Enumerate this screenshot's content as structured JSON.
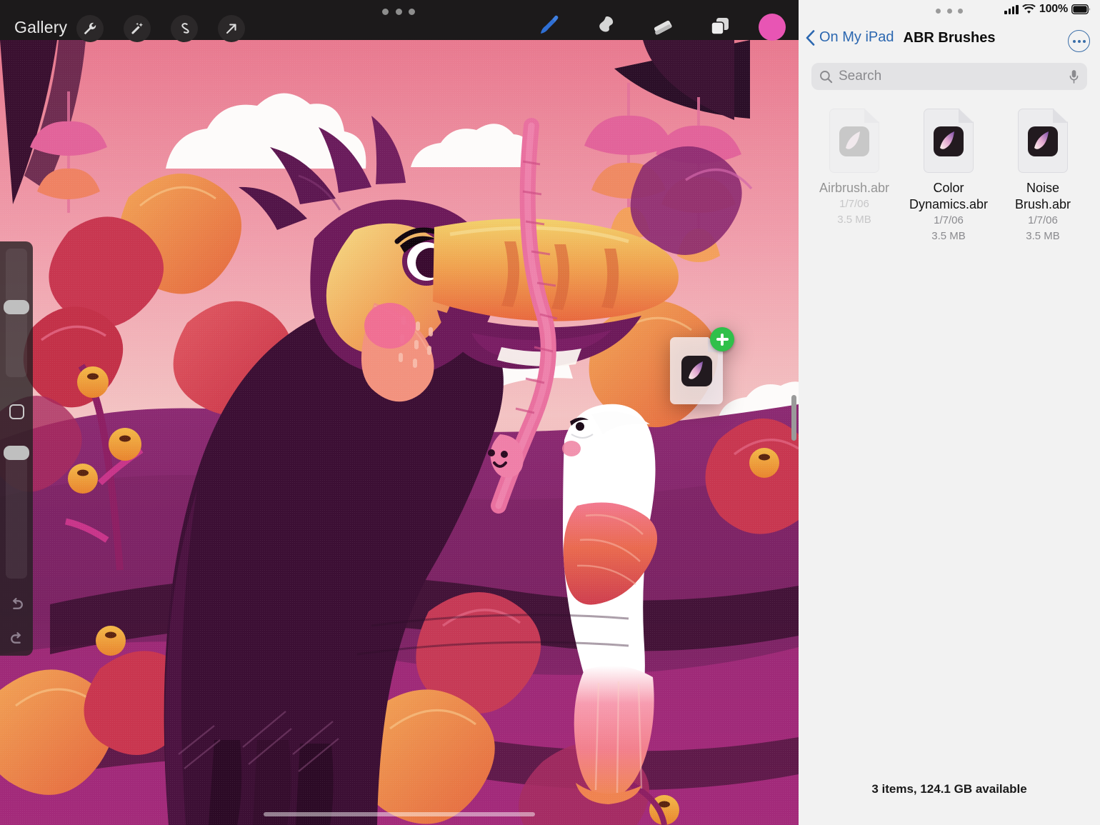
{
  "procreate": {
    "gallery_label": "Gallery",
    "multitask_dots": "multitasking-dots",
    "left_tools": [
      {
        "name": "actions-wrench",
        "label": "Actions"
      },
      {
        "name": "adjustments-wand",
        "label": "Adjustments"
      },
      {
        "name": "selection-scurve",
        "label": "Selection"
      },
      {
        "name": "transform-arrow",
        "label": "Transform"
      }
    ],
    "right_tools": [
      {
        "name": "paint-brush",
        "label": "Paint",
        "active": true
      },
      {
        "name": "smudge",
        "label": "Smudge",
        "active": false
      },
      {
        "name": "eraser",
        "label": "Erase",
        "active": false
      },
      {
        "name": "layers",
        "label": "Layers",
        "active": false
      }
    ],
    "color_swatch": "#e855b4",
    "sidebar": {
      "brush_size_label": "Brush size",
      "opacity_label": "Opacity",
      "modify_label": "Modify",
      "undo_label": "Undo",
      "redo_label": "Redo"
    },
    "drag": {
      "badge": "+",
      "item_name": "Airbrush.abr"
    }
  },
  "files": {
    "status": {
      "battery_percent": "100%",
      "wifi": "wifi-icon",
      "cellular": "cellular-icon"
    },
    "nav": {
      "back_label": "On My iPad",
      "title": "ABR Brushes",
      "more_label": "More"
    },
    "search": {
      "placeholder": "Search",
      "value": ""
    },
    "items": [
      {
        "name": "Airbrush.abr",
        "date": "1/7/06",
        "size": "3.5 MB",
        "dimmed": true,
        "icon": "procreate-brush-icon-grey"
      },
      {
        "name": "Color Dynamics.abr",
        "date": "1/7/06",
        "size": "3.5 MB",
        "dimmed": false,
        "icon": "procreate-brush-icon"
      },
      {
        "name": "Noise Brush.abr",
        "date": "1/7/06",
        "size": "3.5 MB",
        "dimmed": false,
        "icon": "procreate-brush-icon"
      }
    ],
    "footer": "3 items, 124.1 GB available"
  },
  "colors": {
    "accent_blue": "#2b67b0",
    "files_bg": "#f2f2f2",
    "procreate_chrome": "#1c1a1b",
    "drag_badge_green": "#2fc04a",
    "swatch_pink": "#e855b4"
  }
}
